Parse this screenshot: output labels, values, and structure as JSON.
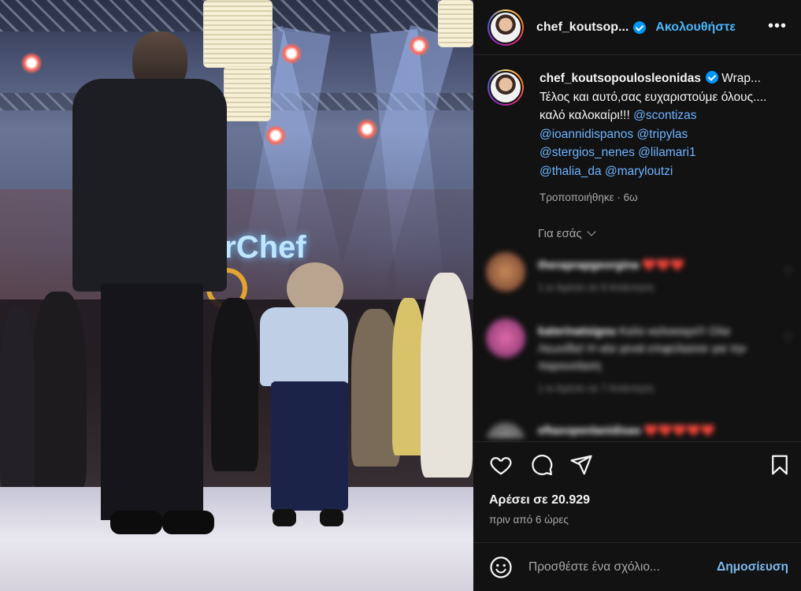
{
  "header": {
    "username": "chef_koutsop...",
    "follow_label": "Ακολουθήστε",
    "more_label": "•••",
    "avatar_icon": "avatar-icon",
    "verified_icon": "verified-badge-icon"
  },
  "caption": {
    "username": "chef_koutsopoulosleonidas",
    "truncated": "Wrap...",
    "text": "Τέλος και αυτό,σας ευχαριστούμε όλους.... καλό καλοκαίρι!!!",
    "mentions": [
      "@scontizas",
      "@ioannidispanos",
      "@tripylas",
      "@stergios_nenes",
      "@lilamari1",
      "@thalia_da",
      "@maryloutzi"
    ],
    "edited": "Τροποποιήθηκε · 6ω"
  },
  "for_you": "Για εσάς",
  "comments": [
    {
      "user": "theraprapgeorgina",
      "text": "❤️❤️❤️",
      "meta": "1 w    Αρέσει σε 8    Απάντηση"
    },
    {
      "user": "katerinatsigou",
      "text": "Καλο καλοκαιρι!!! Ολα Λεωνίδα! Η νέα γενιά επιφύλασσε για την παρουσίαση",
      "meta": "1 w    Αρέσει σε 7    Απάντηση"
    },
    {
      "user": "eftaxopenlanidisas",
      "text": "❤️❤️❤️❤️❤️",
      "meta": ""
    }
  ],
  "likes_label": "Αρέσει σε 20.929",
  "time_ago": "πριν από 6 ώρες",
  "composer": {
    "placeholder": "Προσθέστε ένα σχόλιο...",
    "post_label": "Δημοσίευση"
  },
  "photo": {
    "logo_text": "erChef"
  },
  "colors": {
    "background": "#121212",
    "accent": "#4cb5f9",
    "mention": "#6eb3ff",
    "verified": "#0095f6"
  }
}
